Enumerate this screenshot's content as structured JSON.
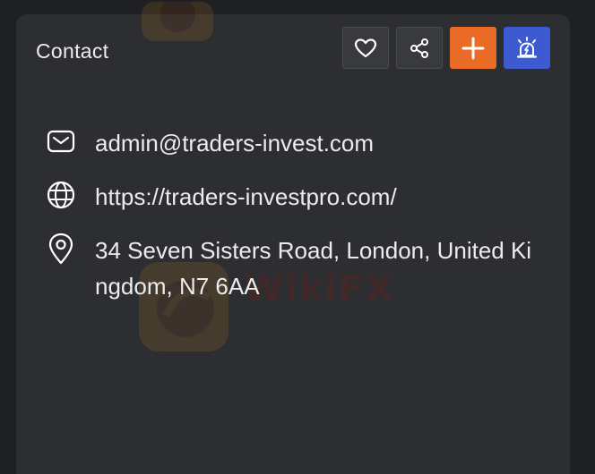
{
  "contact": {
    "title": "Contact",
    "actions": [
      {
        "name": "favorite-button",
        "icon": "heart-icon"
      },
      {
        "name": "share-button",
        "icon": "share-icon"
      },
      {
        "name": "add-button",
        "icon": "plus-icon"
      },
      {
        "name": "alert-button",
        "icon": "alarm-icon"
      }
    ],
    "email": "admin@traders-invest.com",
    "website": "https://traders-investpro.com/",
    "address": "34 Seven Sisters Road, London, United Kingdom, N7 6AA"
  },
  "colors": {
    "background": "#1f2023",
    "card": "#2d2e31",
    "text": "#ececec",
    "orange_button": "#ea6b26",
    "blue_button": "#3d5ad0"
  },
  "watermark": {
    "text": "WikiFX"
  }
}
